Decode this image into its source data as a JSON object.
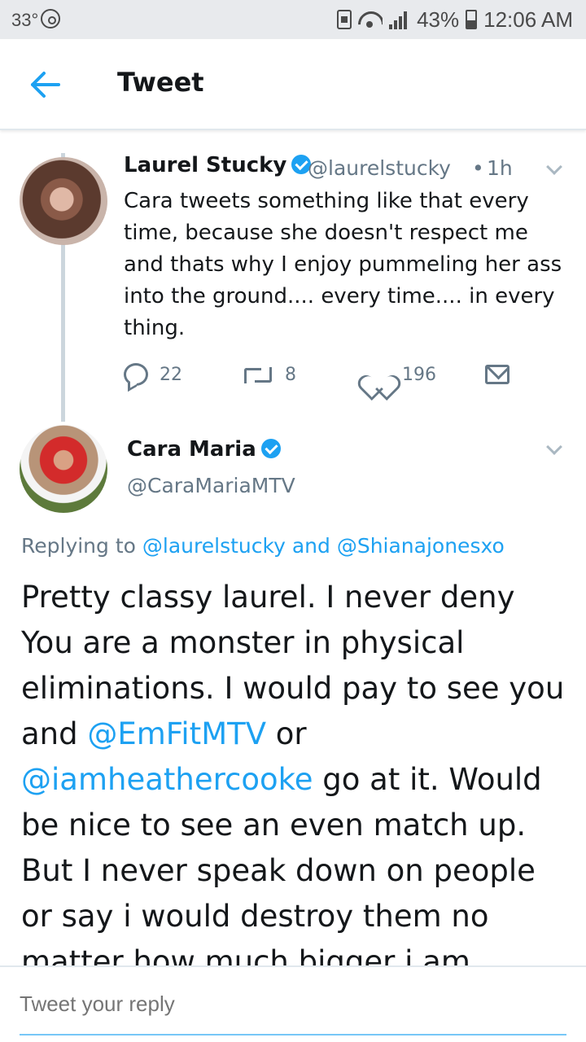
{
  "status_bar": {
    "temperature": "33°",
    "battery": "43%",
    "battery_level": 0.43,
    "time": "12:06 AM"
  },
  "header": {
    "title": "Tweet",
    "back_icon": "arrow-left-icon"
  },
  "tweet_1": {
    "display_name": "Laurel Stucky",
    "handle": "@laurelstucky",
    "separator": "•",
    "time": "1h",
    "text": "Cara tweets something like that every time, because she doesn't respect me and thats why I enjoy pummeling her ass into the ground.... every time.... in every thing.",
    "replies": "22",
    "retweets": "8",
    "likes": "196"
  },
  "tweet_2": {
    "display_name": "Cara Maria",
    "handle": "@CaraMariaMTV",
    "replying_prefix": "Replying to",
    "replying_user_1": "@laurelstucky",
    "replying_and": "and",
    "replying_user_2": "@Shianajonesxo",
    "text_part_1": "Pretty classy laurel. I never deny You are a monster in physical eliminations. I would pay to see you and",
    "mention_1": "@EmFitMTV",
    "text_part_2": "or",
    "mention_2": "@iamheathercooke",
    "text_part_3": "go at it. Would be nice to see an even match up. But I never speak down on people or say i would destroy them no matter how much bigger i am"
  },
  "reply_bar": {
    "placeholder": "Tweet your reply"
  },
  "colors": {
    "accent": "#1da1f2",
    "secondary_text": "#657786",
    "status_bar_bg": "#e8eaed"
  }
}
